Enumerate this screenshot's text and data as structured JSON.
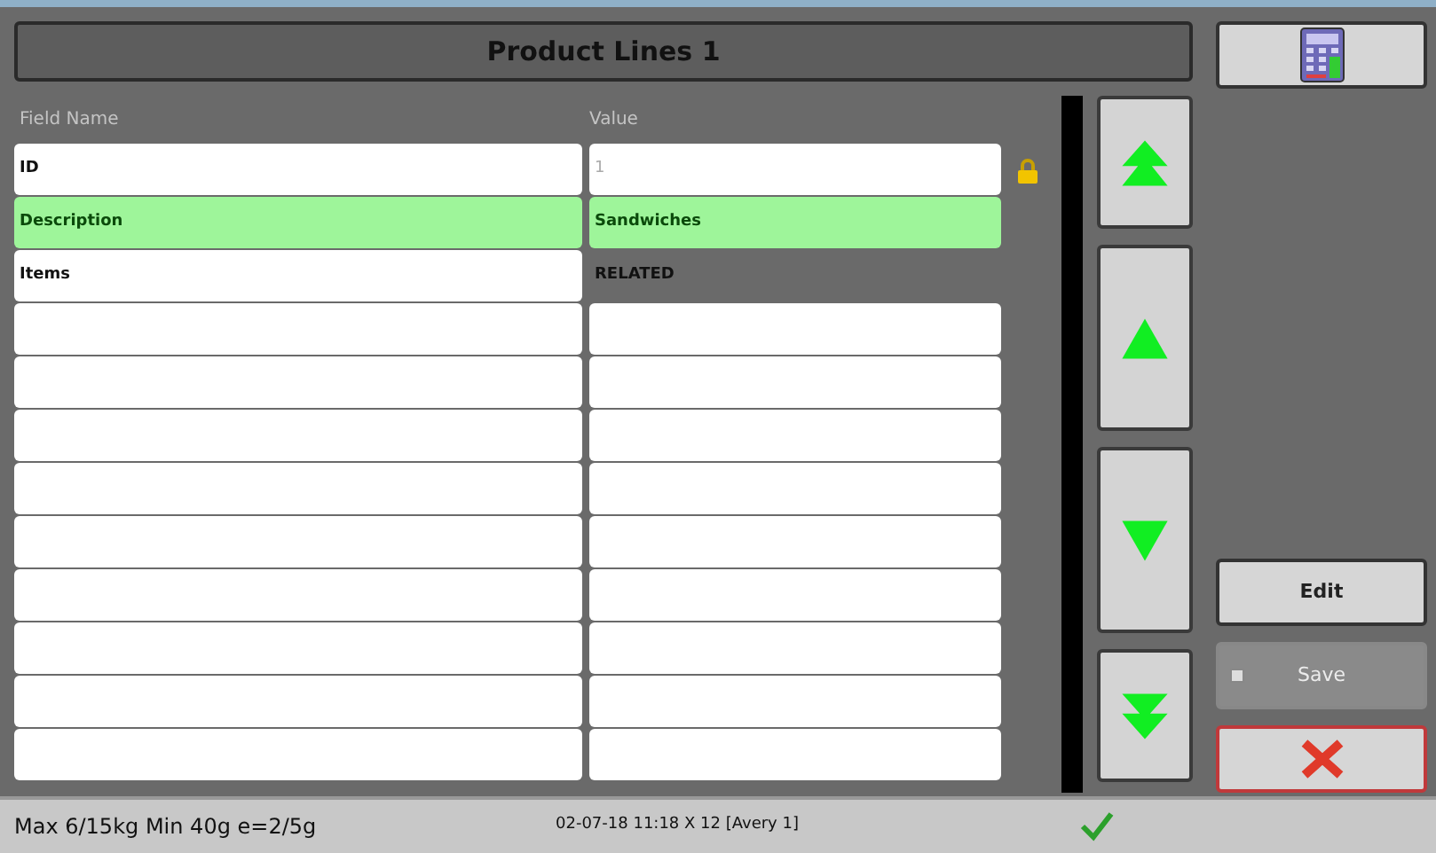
{
  "title": "Product Lines 1",
  "columns": [
    "Field Name",
    "Value"
  ],
  "rows": [
    {
      "field": "ID",
      "value": "1",
      "kind": "input",
      "locked": true,
      "selected": false
    },
    {
      "field": "Description",
      "value": "Sandwiches",
      "kind": "input",
      "locked": false,
      "selected": true
    },
    {
      "field": "Items",
      "value": "RELATED",
      "kind": "plain",
      "locked": false,
      "selected": false
    },
    {
      "selected": false
    },
    {
      "selected": false
    },
    {
      "selected": false
    },
    {
      "selected": false
    },
    {
      "selected": false
    },
    {
      "selected": false
    },
    {
      "selected": false
    },
    {
      "selected": false
    },
    {
      "selected": false
    }
  ],
  "scroll_buttons": [
    {
      "kind": "first"
    },
    {
      "kind": "up"
    },
    {
      "kind": "down"
    },
    {
      "kind": "last"
    }
  ],
  "actions": [
    {
      "kind": "edit",
      "label": "Edit",
      "disabled": false
    },
    {
      "kind": "save",
      "label": "Save",
      "disabled": true
    },
    {
      "kind": "cancel",
      "disabled": false
    }
  ],
  "status_bar": {
    "capacity": "Max 6/15kg Min 40g e=2/5g",
    "info": "02-07-18 11:18 X 12 [Avery 1]",
    "ok": true
  }
}
